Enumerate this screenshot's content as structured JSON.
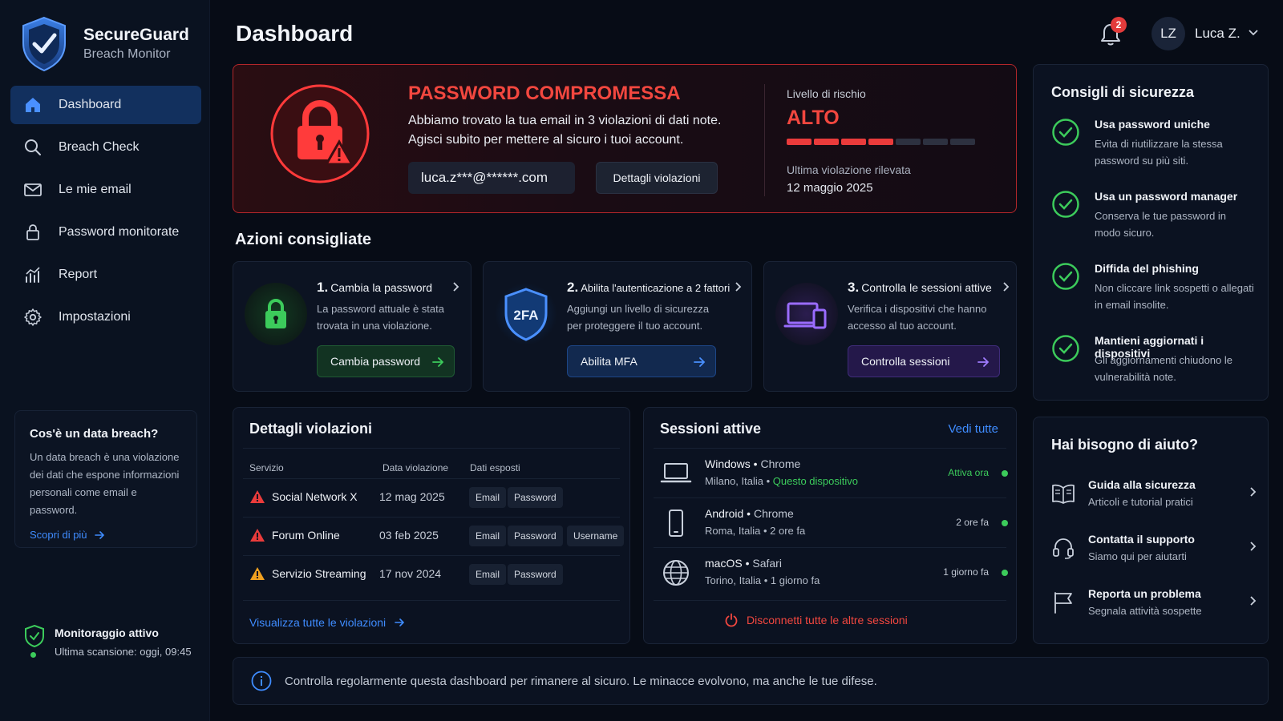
{
  "brand": {
    "title": "SecureGuard",
    "subtitle": "Breach Monitor"
  },
  "sidebar": {
    "items": [
      {
        "label": "Dashboard",
        "icon": "home-icon",
        "active": true
      },
      {
        "label": "Breach Check",
        "icon": "search-icon"
      },
      {
        "label": "Le mie email",
        "icon": "mail-icon"
      },
      {
        "label": "Password monitorate",
        "icon": "lock-icon"
      },
      {
        "label": "Report",
        "icon": "chart-icon"
      },
      {
        "label": "Impostazioni",
        "icon": "gear-icon"
      }
    ],
    "info_card": {
      "title": "Cos'è un data breach?",
      "body": "Un data breach è una violazione dei dati che espone informazioni personali come email e password.",
      "link": "Scopri di più"
    },
    "monitor": {
      "title": "Monitoraggio attivo",
      "subtitle": "Ultima scansione: oggi, 09:45"
    }
  },
  "header": {
    "title": "Dashboard",
    "notifications": "2",
    "avatar_initials": "LZ",
    "user_name": "Luca Z."
  },
  "alert": {
    "title": "PASSWORD COMPROMESSA",
    "line1": "Abbiamo trovato la tua email in 3 violazioni di dati note.",
    "line2": "Agisci subito per mettere al sicuro i tuoi account.",
    "email": "luca.z***@******.com",
    "details_button": "Dettagli violazioni",
    "risk_label": "Livello di rischio",
    "risk_value": "ALTO",
    "risk_level": 4,
    "risk_max": 7,
    "last_label": "Ultima violazione rilevata",
    "last_date": "12 maggio 2025"
  },
  "actions": {
    "title": "Azioni consigliate",
    "cards": [
      {
        "num": "1.",
        "title": "Cambia la password",
        "desc1": "La password attuale è stata",
        "desc2": "trovata in una violazione.",
        "button": "Cambia password",
        "color": "#3ccb5b"
      },
      {
        "num": "2.",
        "title": "Abilita l'autenticazione a 2 fattori",
        "desc1": "Aggiungi un livello di sicurezza",
        "desc2": "per proteggere il tuo account.",
        "button": "Abilita MFA",
        "icon_text": "2FA",
        "color": "#3f8cff"
      },
      {
        "num": "3.",
        "title": "Controlla le sessioni attive",
        "desc1": "Verifica i dispositivi che hanno",
        "desc2": "accesso al tuo account.",
        "button": "Controlla sessioni",
        "color": "#8a5cf6"
      }
    ]
  },
  "breaches": {
    "title": "Dettagli violazioni",
    "columns": [
      "Servizio",
      "Data violazione",
      "Dati esposti"
    ],
    "rows": [
      {
        "service": "Social Network X",
        "date": "12 mag 2025",
        "tags": [
          "Email",
          "Password"
        ],
        "severity_color": "#ea3b3b"
      },
      {
        "service": "Forum Online",
        "date": "03 feb 2025",
        "tags": [
          "Email",
          "Password",
          "Username"
        ],
        "severity_color": "#ea3b3b"
      },
      {
        "service": "Servizio Streaming",
        "date": "17 nov 2024",
        "tags": [
          "Email",
          "Password"
        ],
        "severity_color": "#f0a020"
      }
    ],
    "link": "Visualizza tutte le violazioni"
  },
  "sessions": {
    "title": "Sessioni attive",
    "see_all": "Vedi tutte",
    "rows": [
      {
        "os": "Windows",
        "browser": "Chrome",
        "location": "Milano, Italia",
        "extra": "Questo dispositivo",
        "when": "Attiva ora",
        "device": "laptop-icon"
      },
      {
        "os": "Android",
        "browser": "Chrome",
        "location": "Roma, Italia",
        "extra": "2 ore fa",
        "when": "2 ore fa",
        "device": "phone-icon"
      },
      {
        "os": "macOS",
        "browser": "Safari",
        "location": "Torino, Italia",
        "extra": "1 giorno fa",
        "when": "1 giorno fa",
        "device": "globe-icon"
      }
    ],
    "disconnect": "Disconnetti tutte le altre sessioni"
  },
  "tips": {
    "title": "Consigli di sicurezza",
    "items": [
      {
        "title": "Usa password uniche",
        "desc": "Evita di riutilizzare la stessa password su più siti."
      },
      {
        "title": "Usa un password manager",
        "desc": "Conserva le tue password in modo sicuro."
      },
      {
        "title": "Diffida del phishing",
        "desc": "Non cliccare link sospetti o allegati in email insolite."
      },
      {
        "title": "Mantieni aggiornati i dispositivi",
        "desc": "Gli aggiornamenti chiudono le vulnerabilità note."
      }
    ]
  },
  "help": {
    "title": "Hai bisogno di aiuto?",
    "items": [
      {
        "title": "Guida alla sicurezza",
        "subtitle": "Articoli e tutorial pratici",
        "icon": "book-icon"
      },
      {
        "title": "Contatta il supporto",
        "subtitle": "Siamo qui per aiutarti",
        "icon": "headset-icon"
      },
      {
        "title": "Reporta un problema",
        "subtitle": "Segnala attività sospette",
        "icon": "flag-icon"
      }
    ]
  },
  "footer": {
    "text": "Controlla regolarmente questa dashboard per rimanere al sicuro. Le minacce evolvono, ma anche le tue difese."
  },
  "colors": {
    "accent": "#3f8cff",
    "danger": "#ea3b3b",
    "success": "#3ccb5b",
    "warning": "#f0a020",
    "active_nav": "#12305e"
  }
}
